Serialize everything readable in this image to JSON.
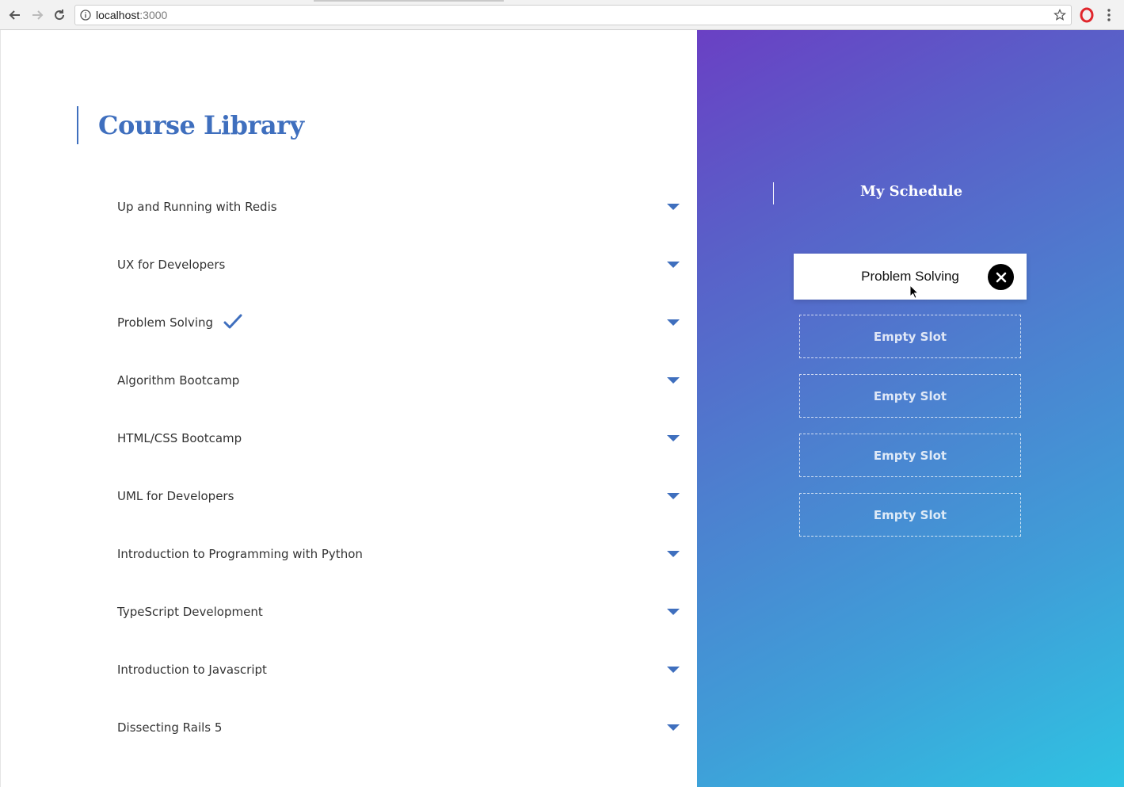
{
  "browser": {
    "url_host": "localhost",
    "url_port": ":3000",
    "icons": [
      "back-icon",
      "forward-icon",
      "reload-icon",
      "info-icon",
      "star-icon",
      "opera-icon",
      "menu-icon"
    ]
  },
  "library": {
    "title": "Course Library",
    "accent": "#3f6fbe",
    "courses": [
      {
        "name": "Up and Running with Redis",
        "enrolled": false
      },
      {
        "name": "UX for Developers",
        "enrolled": false
      },
      {
        "name": "Problem Solving",
        "enrolled": true
      },
      {
        "name": "Algorithm Bootcamp",
        "enrolled": false
      },
      {
        "name": "HTML/CSS Bootcamp",
        "enrolled": false
      },
      {
        "name": "UML for Developers",
        "enrolled": false
      },
      {
        "name": "Introduction to Programming with Python",
        "enrolled": false
      },
      {
        "name": "TypeScript Development",
        "enrolled": false
      },
      {
        "name": "Introduction to Javascript",
        "enrolled": false
      },
      {
        "name": "Dissecting Rails 5",
        "enrolled": false
      }
    ]
  },
  "schedule": {
    "title": "My Schedule",
    "filled_slot": "Problem Solving",
    "empty_slots": [
      "Empty Slot",
      "Empty Slot",
      "Empty Slot",
      "Empty Slot"
    ],
    "gradient": [
      "#6a40c4",
      "#2fc3e2"
    ]
  }
}
